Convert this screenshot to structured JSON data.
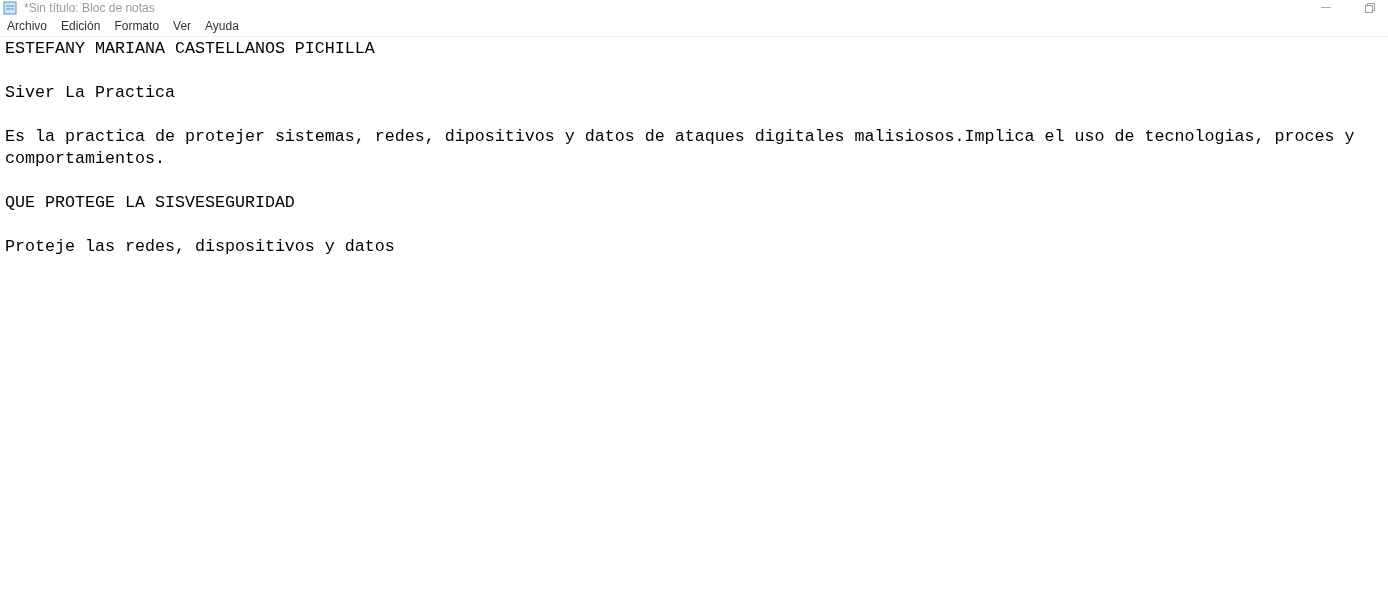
{
  "window": {
    "title": "*Sin título: Bloc de notas"
  },
  "menu": [
    "Archivo",
    "Edición",
    "Formato",
    "Ver",
    "Ayuda"
  ],
  "document": {
    "paragraphs": [
      "ESTEFANY MARIANA CASTELLANOS PICHILLA",
      "Siver La Practica",
      "Es la practica de protejer sistemas, redes, dipositivos y datos de ataques digitales malisiosos.Implica el uso de tecnologias, proces y comportamientos.",
      "QUE PROTEGE LA SISVESEGURIDAD",
      "Proteje las redes, dispositivos y datos"
    ]
  }
}
